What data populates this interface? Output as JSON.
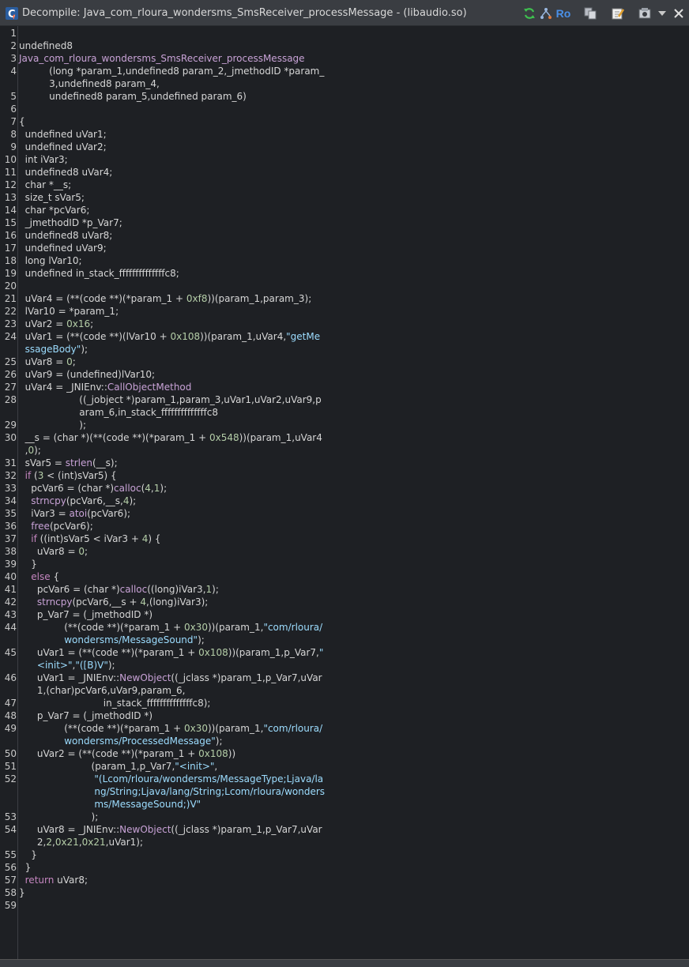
{
  "window": {
    "title": "Decompile: Java_com_rloura_wondersms_SmsReceiver_processMessage -  (libaudio.so)"
  },
  "toolbar": {
    "ro_label": "Ro",
    "icons": [
      "refresh-icon",
      "graph-icon",
      "ro-icon",
      "copy-icon",
      "edit-icon",
      "snapshot-icon",
      "menu-chevron-icon",
      "close-icon"
    ]
  },
  "code": {
    "lines": [
      {
        "n": "1",
        "segs": []
      },
      {
        "n": "2",
        "segs": [
          {
            "c": "t",
            "v": "undefined8"
          }
        ]
      },
      {
        "n": "3",
        "segs": [
          {
            "c": "f",
            "v": "Java_com_rloura_wondersms_SmsReceiver_processMessage"
          }
        ]
      },
      {
        "n": "4",
        "segs": [
          {
            "c": "t",
            "v": "          (long *param_1,undefined8 param_2,_jmethodID *param_"
          }
        ]
      },
      {
        "n": "",
        "segs": [
          {
            "c": "t",
            "v": "          3,undefined8 param_4,"
          }
        ]
      },
      {
        "n": "5",
        "segs": [
          {
            "c": "t",
            "v": "          undefined8 param_5,undefined param_6)"
          }
        ]
      },
      {
        "n": "6",
        "segs": []
      },
      {
        "n": "7",
        "segs": [
          {
            "c": "t",
            "v": "{"
          }
        ]
      },
      {
        "n": "8",
        "segs": [
          {
            "c": "t",
            "v": "  undefined uVar1;"
          }
        ]
      },
      {
        "n": "9",
        "segs": [
          {
            "c": "t",
            "v": "  undefined uVar2;"
          }
        ]
      },
      {
        "n": "10",
        "segs": [
          {
            "c": "t",
            "v": "  int iVar3;"
          }
        ]
      },
      {
        "n": "11",
        "segs": [
          {
            "c": "t",
            "v": "  undefined8 uVar4;"
          }
        ]
      },
      {
        "n": "12",
        "segs": [
          {
            "c": "t",
            "v": "  char *__s;"
          }
        ]
      },
      {
        "n": "13",
        "segs": [
          {
            "c": "t",
            "v": "  size_t sVar5;"
          }
        ]
      },
      {
        "n": "14",
        "segs": [
          {
            "c": "t",
            "v": "  char *pcVar6;"
          }
        ]
      },
      {
        "n": "15",
        "segs": [
          {
            "c": "t",
            "v": "  _jmethodID *p_Var7;"
          }
        ]
      },
      {
        "n": "16",
        "segs": [
          {
            "c": "t",
            "v": "  undefined8 uVar8;"
          }
        ]
      },
      {
        "n": "17",
        "segs": [
          {
            "c": "t",
            "v": "  undefined uVar9;"
          }
        ]
      },
      {
        "n": "18",
        "segs": [
          {
            "c": "t",
            "v": "  long lVar10;"
          }
        ]
      },
      {
        "n": "19",
        "segs": [
          {
            "c": "t",
            "v": "  undefined in_stack_ffffffffffffffc8;"
          }
        ]
      },
      {
        "n": "20",
        "segs": []
      },
      {
        "n": "21",
        "segs": [
          {
            "c": "t",
            "v": "  uVar4 = (**(code **)(*param_1 + "
          },
          {
            "c": "n",
            "v": "0xf8"
          },
          {
            "c": "t",
            "v": "))(param_1,param_3);"
          }
        ]
      },
      {
        "n": "22",
        "segs": [
          {
            "c": "t",
            "v": "  lVar10 = *param_1;"
          }
        ]
      },
      {
        "n": "23",
        "segs": [
          {
            "c": "t",
            "v": "  uVar2 = "
          },
          {
            "c": "n",
            "v": "0x16"
          },
          {
            "c": "t",
            "v": ";"
          }
        ]
      },
      {
        "n": "24",
        "segs": [
          {
            "c": "t",
            "v": "  uVar1 = (**(code **)(lVar10 + "
          },
          {
            "c": "n",
            "v": "0x108"
          },
          {
            "c": "t",
            "v": "))(param_1,uVar4,"
          },
          {
            "c": "s",
            "v": "\"getMe"
          }
        ]
      },
      {
        "n": "",
        "segs": [
          {
            "c": "s",
            "v": "  ssageBody\""
          },
          {
            "c": "t",
            "v": ");"
          }
        ]
      },
      {
        "n": "25",
        "segs": [
          {
            "c": "t",
            "v": "  uVar8 = "
          },
          {
            "c": "n",
            "v": "0"
          },
          {
            "c": "t",
            "v": ";"
          }
        ]
      },
      {
        "n": "26",
        "segs": [
          {
            "c": "t",
            "v": "  uVar9 = (undefined)lVar10;"
          }
        ]
      },
      {
        "n": "27",
        "segs": [
          {
            "c": "t",
            "v": "  uVar4 = _JNIEnv::"
          },
          {
            "c": "f",
            "v": "CallObjectMethod"
          }
        ]
      },
      {
        "n": "28",
        "segs": [
          {
            "c": "t",
            "v": "                    ((_jobject *)param_1,param_3,uVar1,uVar2,uVar9,p"
          }
        ]
      },
      {
        "n": "",
        "segs": [
          {
            "c": "t",
            "v": "                    aram_6,in_stack_ffffffffffffffc8"
          }
        ]
      },
      {
        "n": "29",
        "segs": [
          {
            "c": "t",
            "v": "                    );"
          }
        ]
      },
      {
        "n": "30",
        "segs": [
          {
            "c": "t",
            "v": "  __s = (char *)(**(code **)(*param_1 + "
          },
          {
            "c": "n",
            "v": "0x548"
          },
          {
            "c": "t",
            "v": "))(param_1,uVar4"
          }
        ]
      },
      {
        "n": "",
        "segs": [
          {
            "c": "t",
            "v": "  ,"
          },
          {
            "c": "n",
            "v": "0"
          },
          {
            "c": "t",
            "v": ");"
          }
        ]
      },
      {
        "n": "31",
        "segs": [
          {
            "c": "t",
            "v": "  sVar5 = "
          },
          {
            "c": "f",
            "v": "strlen"
          },
          {
            "c": "t",
            "v": "(__s);"
          }
        ]
      },
      {
        "n": "32",
        "segs": [
          {
            "c": "t",
            "v": "  "
          },
          {
            "c": "k",
            "v": "if"
          },
          {
            "c": "t",
            "v": " ("
          },
          {
            "c": "n",
            "v": "3"
          },
          {
            "c": "t",
            "v": " < (int)sVar5) {"
          }
        ]
      },
      {
        "n": "33",
        "segs": [
          {
            "c": "t",
            "v": "    pcVar6 = (char *)"
          },
          {
            "c": "f",
            "v": "calloc"
          },
          {
            "c": "t",
            "v": "("
          },
          {
            "c": "n",
            "v": "4"
          },
          {
            "c": "t",
            "v": ","
          },
          {
            "c": "n",
            "v": "1"
          },
          {
            "c": "t",
            "v": ");"
          }
        ]
      },
      {
        "n": "34",
        "segs": [
          {
            "c": "t",
            "v": "    "
          },
          {
            "c": "f",
            "v": "strncpy"
          },
          {
            "c": "t",
            "v": "(pcVar6,__s,"
          },
          {
            "c": "n",
            "v": "4"
          },
          {
            "c": "t",
            "v": ");"
          }
        ]
      },
      {
        "n": "35",
        "segs": [
          {
            "c": "t",
            "v": "    iVar3 = "
          },
          {
            "c": "f",
            "v": "atoi"
          },
          {
            "c": "t",
            "v": "(pcVar6);"
          }
        ]
      },
      {
        "n": "36",
        "segs": [
          {
            "c": "t",
            "v": "    "
          },
          {
            "c": "f",
            "v": "free"
          },
          {
            "c": "t",
            "v": "(pcVar6);"
          }
        ]
      },
      {
        "n": "37",
        "segs": [
          {
            "c": "t",
            "v": "    "
          },
          {
            "c": "k",
            "v": "if"
          },
          {
            "c": "t",
            "v": " ((int)sVar5 < iVar3 + "
          },
          {
            "c": "n",
            "v": "4"
          },
          {
            "c": "t",
            "v": ") {"
          }
        ]
      },
      {
        "n": "38",
        "segs": [
          {
            "c": "t",
            "v": "      uVar8 = "
          },
          {
            "c": "n",
            "v": "0"
          },
          {
            "c": "t",
            "v": ";"
          }
        ]
      },
      {
        "n": "39",
        "segs": [
          {
            "c": "t",
            "v": "    }"
          }
        ]
      },
      {
        "n": "40",
        "segs": [
          {
            "c": "t",
            "v": "    "
          },
          {
            "c": "k",
            "v": "else"
          },
          {
            "c": "t",
            "v": " {"
          }
        ]
      },
      {
        "n": "41",
        "segs": [
          {
            "c": "t",
            "v": "      pcVar6 = (char *)"
          },
          {
            "c": "f",
            "v": "calloc"
          },
          {
            "c": "t",
            "v": "((long)iVar3,"
          },
          {
            "c": "n",
            "v": "1"
          },
          {
            "c": "t",
            "v": ");"
          }
        ]
      },
      {
        "n": "42",
        "segs": [
          {
            "c": "t",
            "v": "      "
          },
          {
            "c": "f",
            "v": "strncpy"
          },
          {
            "c": "t",
            "v": "(pcVar6,__s + "
          },
          {
            "c": "n",
            "v": "4"
          },
          {
            "c": "t",
            "v": ",(long)iVar3);"
          }
        ]
      },
      {
        "n": "43",
        "segs": [
          {
            "c": "t",
            "v": "      p_Var7 = (_jmethodID *)"
          }
        ]
      },
      {
        "n": "44",
        "segs": [
          {
            "c": "t",
            "v": "               (**(code **)(*param_1 + "
          },
          {
            "c": "n",
            "v": "0x30"
          },
          {
            "c": "t",
            "v": "))(param_1,"
          },
          {
            "c": "s",
            "v": "\"com/rloura/"
          }
        ]
      },
      {
        "n": "",
        "segs": [
          {
            "c": "s",
            "v": "               wondersms/MessageSound\""
          },
          {
            "c": "t",
            "v": ");"
          }
        ]
      },
      {
        "n": "45",
        "segs": [
          {
            "c": "t",
            "v": "      uVar1 = (**(code **)(*param_1 + "
          },
          {
            "c": "n",
            "v": "0x108"
          },
          {
            "c": "t",
            "v": "))(param_1,p_Var7,"
          },
          {
            "c": "s",
            "v": "\""
          }
        ]
      },
      {
        "n": "",
        "segs": [
          {
            "c": "s",
            "v": "      <init>\""
          },
          {
            "c": "t",
            "v": ","
          },
          {
            "c": "s",
            "v": "\"([B)V\""
          },
          {
            "c": "t",
            "v": ");"
          }
        ]
      },
      {
        "n": "46",
        "segs": [
          {
            "c": "t",
            "v": "      uVar1 = _JNIEnv::"
          },
          {
            "c": "f",
            "v": "NewObject"
          },
          {
            "c": "t",
            "v": "((_jclass *)param_1,p_Var7,uVar"
          }
        ]
      },
      {
        "n": "",
        "segs": [
          {
            "c": "t",
            "v": "      1,(char)pcVar6,uVar9,param_6,"
          }
        ]
      },
      {
        "n": "47",
        "segs": [
          {
            "c": "t",
            "v": "                            in_stack_ffffffffffffffc8);"
          }
        ]
      },
      {
        "n": "48",
        "segs": [
          {
            "c": "t",
            "v": "      p_Var7 = (_jmethodID *)"
          }
        ]
      },
      {
        "n": "49",
        "segs": [
          {
            "c": "t",
            "v": "               (**(code **)(*param_1 + "
          },
          {
            "c": "n",
            "v": "0x30"
          },
          {
            "c": "t",
            "v": "))(param_1,"
          },
          {
            "c": "s",
            "v": "\"com/rloura/"
          }
        ]
      },
      {
        "n": "",
        "segs": [
          {
            "c": "s",
            "v": "               wondersms/ProcessedMessage\""
          },
          {
            "c": "t",
            "v": ");"
          }
        ]
      },
      {
        "n": "50",
        "segs": [
          {
            "c": "t",
            "v": "      uVar2 = (**(code **)(*param_1 + "
          },
          {
            "c": "n",
            "v": "0x108"
          },
          {
            "c": "t",
            "v": "))"
          }
        ]
      },
      {
        "n": "51",
        "segs": [
          {
            "c": "t",
            "v": "                        (param_1,p_Var7,"
          },
          {
            "c": "s",
            "v": "\"<init>\""
          },
          {
            "c": "t",
            "v": ","
          }
        ]
      },
      {
        "n": "52",
        "segs": [
          {
            "c": "s",
            "v": "                         \"(Lcom/rloura/wondersms/MessageType;Ljava/la"
          }
        ]
      },
      {
        "n": "",
        "segs": [
          {
            "c": "s",
            "v": "                         ng/String;Ljava/lang/String;Lcom/rloura/wonders"
          }
        ]
      },
      {
        "n": "",
        "segs": [
          {
            "c": "s",
            "v": "                         ms/MessageSound;)V\""
          }
        ]
      },
      {
        "n": "53",
        "segs": [
          {
            "c": "t",
            "v": "                        );"
          }
        ]
      },
      {
        "n": "54",
        "segs": [
          {
            "c": "t",
            "v": "      uVar8 = _JNIEnv::"
          },
          {
            "c": "f",
            "v": "NewObject"
          },
          {
            "c": "t",
            "v": "((_jclass *)param_1,p_Var7,uVar"
          }
        ]
      },
      {
        "n": "",
        "segs": [
          {
            "c": "t",
            "v": "      2,"
          },
          {
            "c": "n",
            "v": "2"
          },
          {
            "c": "t",
            "v": ","
          },
          {
            "c": "n",
            "v": "0x21"
          },
          {
            "c": "t",
            "v": ","
          },
          {
            "c": "n",
            "v": "0x21"
          },
          {
            "c": "t",
            "v": ",uVar1);"
          }
        ]
      },
      {
        "n": "55",
        "segs": [
          {
            "c": "t",
            "v": "    }"
          }
        ]
      },
      {
        "n": "56",
        "segs": [
          {
            "c": "t",
            "v": "  }"
          }
        ]
      },
      {
        "n": "57",
        "segs": [
          {
            "c": "t",
            "v": "  "
          },
          {
            "c": "k",
            "v": "return"
          },
          {
            "c": "t",
            "v": " uVar8;"
          }
        ]
      },
      {
        "n": "58",
        "segs": [
          {
            "c": "t",
            "v": "}"
          }
        ]
      },
      {
        "n": "59",
        "segs": []
      }
    ]
  }
}
